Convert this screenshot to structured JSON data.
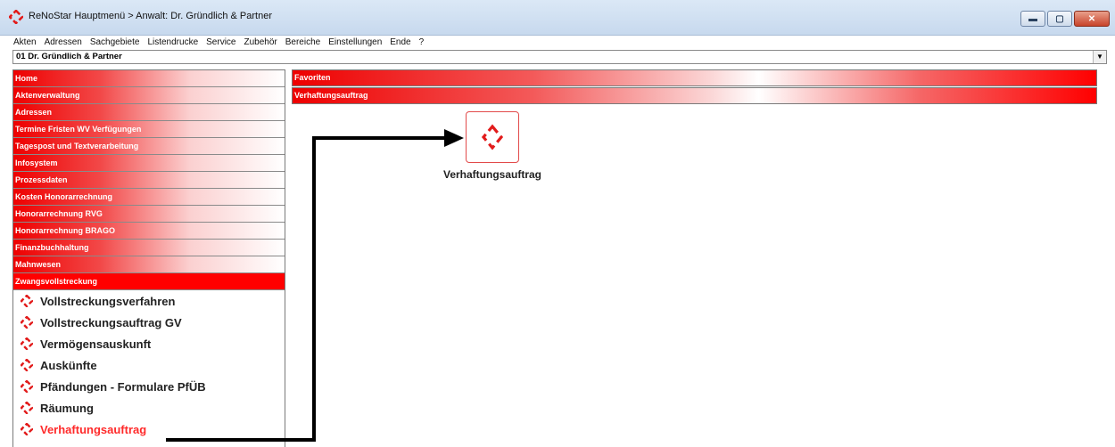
{
  "window": {
    "title": "ReNoStar Hauptmenü > Anwalt: Dr. Gründlich & Partner",
    "icon": "renostar-diamond-icon",
    "controls": [
      "minimize",
      "maximize",
      "close"
    ]
  },
  "menubar": [
    "Akten",
    "Adressen",
    "Sachgebiete",
    "Listendrucke",
    "Service",
    "Zubehör",
    "Bereiche",
    "Einstellungen",
    "Ende",
    "?"
  ],
  "selector": {
    "value": "01 Dr. Gründlich & Partner"
  },
  "nav": {
    "sections": [
      "Home",
      "Aktenverwaltung",
      "Adressen",
      "Termine Fristen WV Verfügungen",
      "Tagespost und Textverarbeitung",
      "Infosystem",
      "Prozessdaten",
      "Kosten Honorarrechnung",
      "Honorarrechnung RVG",
      "Honorarrechnung BRAGO",
      "Finanzbuchhaltung",
      "Mahnwesen",
      "Zwangsvollstreckung"
    ],
    "active_section": "Zwangsvollstreckung",
    "subitems": [
      "Vollstreckungsverfahren",
      "Vollstreckungsauftrag GV",
      "Vermögensauskunft",
      "Auskünfte",
      "Pfändungen - Formulare PfÜB",
      "Räumung",
      "Verhaftungsauftrag"
    ],
    "selected_subitem": "Verhaftungsauftrag"
  },
  "right": {
    "bars": [
      "Favoriten",
      "Verhaftungsauftrag"
    ],
    "tile": {
      "label": "Verhaftungsauftrag",
      "icon": "renostar-diamond-icon"
    }
  },
  "colors": {
    "accent": "#ff0000",
    "selected_text": "#ff2a2a"
  }
}
